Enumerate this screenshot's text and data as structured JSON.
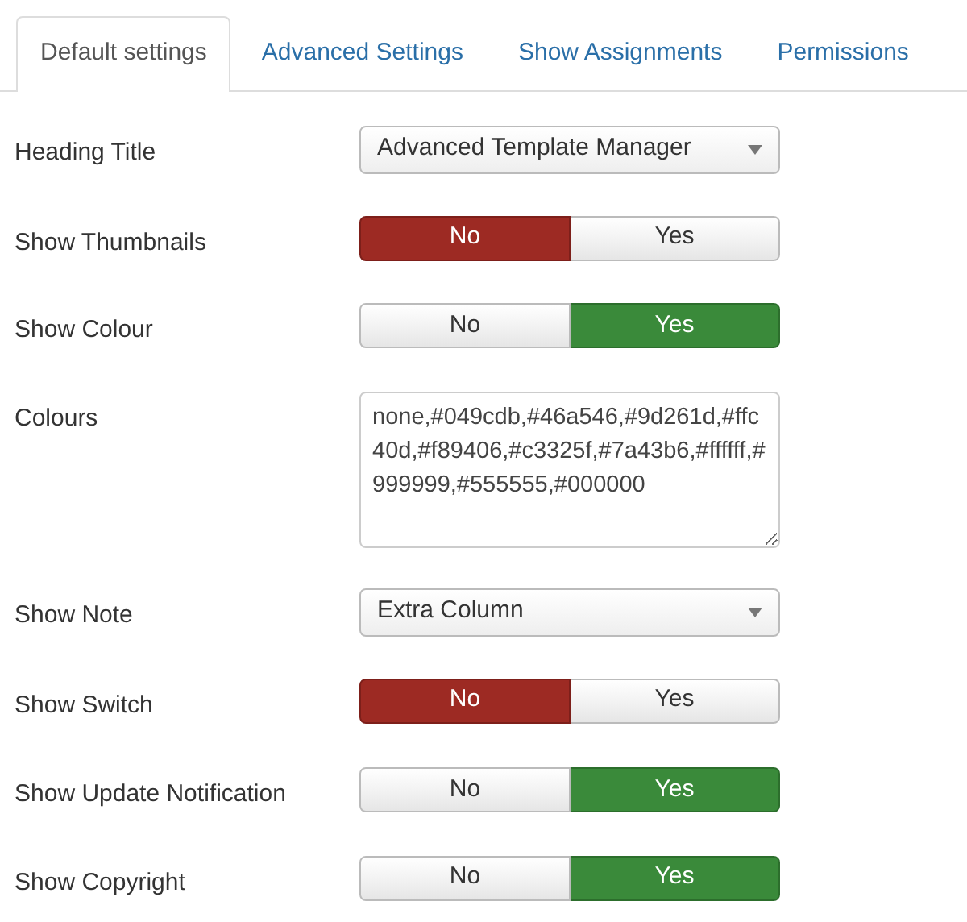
{
  "tabs": [
    {
      "label": "Default settings",
      "selected": true
    },
    {
      "label": "Advanced Settings",
      "selected": false
    },
    {
      "label": "Show Assignments",
      "selected": false
    },
    {
      "label": "Permissions",
      "selected": false
    }
  ],
  "fields": [
    {
      "label": "Heading Title",
      "kind": "select",
      "value": "Advanced Template Manager"
    },
    {
      "label": "Show Thumbnails",
      "kind": "toggle",
      "options": [
        {
          "label": "No",
          "selected": true
        },
        {
          "label": "Yes",
          "selected": false
        }
      ]
    },
    {
      "label": "Show Colour",
      "kind": "toggle",
      "options": [
        {
          "label": "No",
          "selected": false
        },
        {
          "label": "Yes",
          "selected": true
        }
      ]
    },
    {
      "label": "Colours",
      "kind": "textarea",
      "value": "none,#049cdb,#46a546,#9d261d,#ffc40d,#f89406,#c3325f,#7a43b6,#ffffff,#999999,#555555,#000000"
    },
    {
      "label": "Show Note",
      "kind": "select",
      "value": "Extra Column"
    },
    {
      "label": "Show Switch",
      "kind": "toggle",
      "options": [
        {
          "label": "No",
          "selected": true
        },
        {
          "label": "Yes",
          "selected": false
        }
      ]
    },
    {
      "label": "Show Update Notification",
      "kind": "toggle",
      "options": [
        {
          "label": "No",
          "selected": false
        },
        {
          "label": "Yes",
          "selected": true
        }
      ]
    },
    {
      "label": "Show Copyright",
      "kind": "toggle",
      "options": [
        {
          "label": "No",
          "selected": false
        },
        {
          "label": "Yes",
          "selected": true
        }
      ]
    }
  ]
}
